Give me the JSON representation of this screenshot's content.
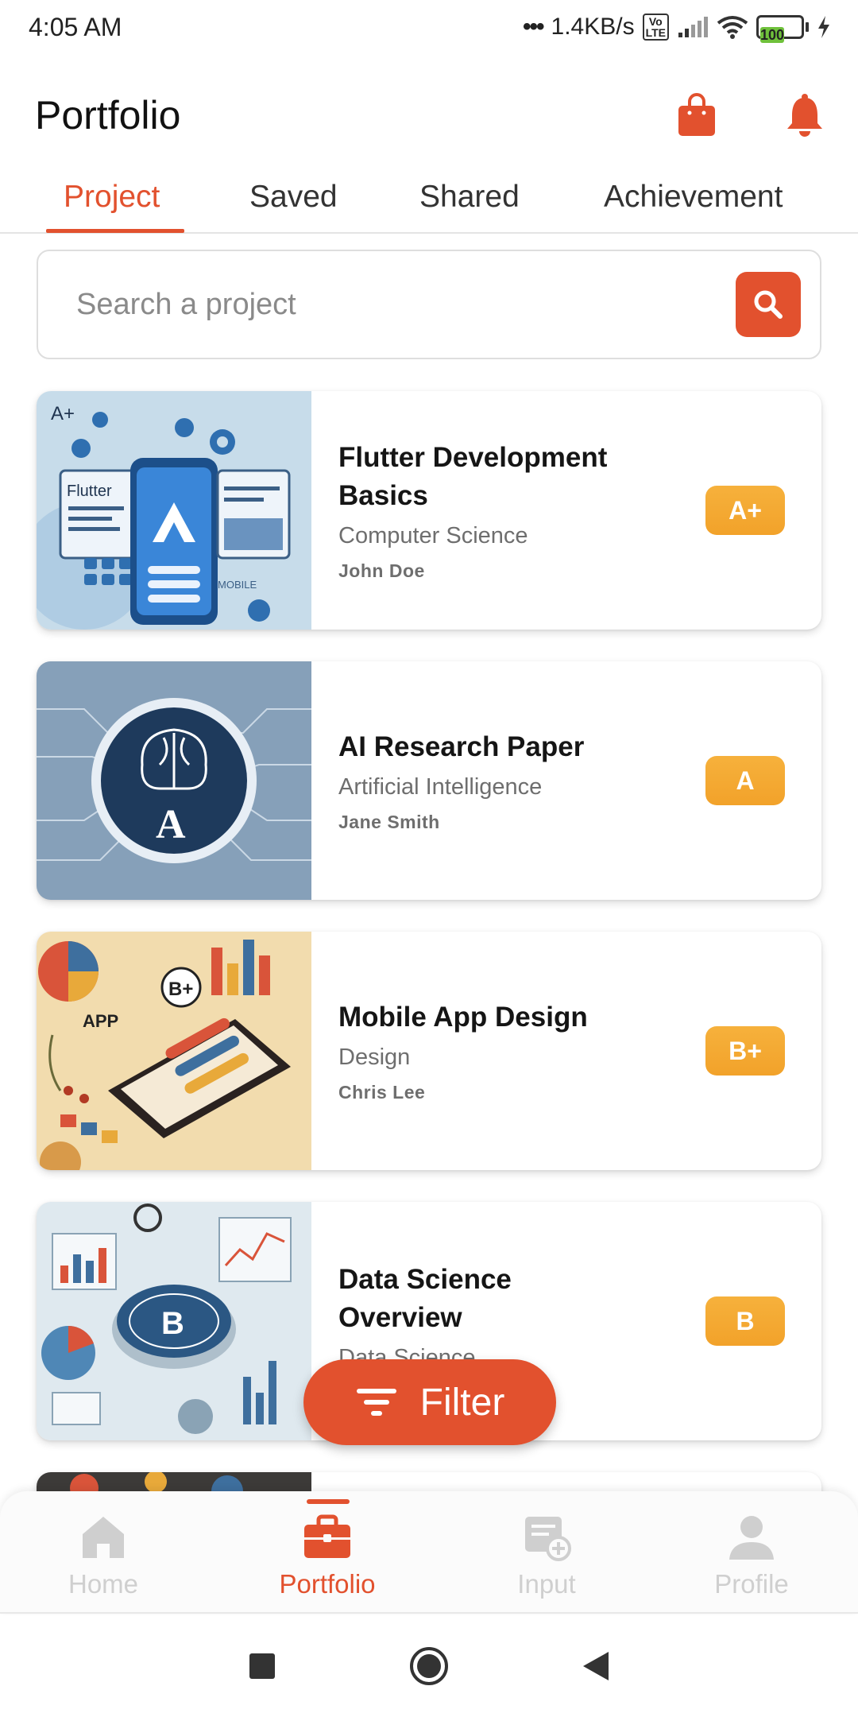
{
  "status_bar": {
    "time": "4:05 AM",
    "network_speed": "1.4KB/s",
    "volte": "Vo LTE",
    "battery": "100"
  },
  "header": {
    "title": "Portfolio",
    "icons": [
      "shopping-bag-icon",
      "bell-icon"
    ]
  },
  "tabs": [
    {
      "label": "Project",
      "active": true
    },
    {
      "label": "Saved",
      "active": false
    },
    {
      "label": "Shared",
      "active": false
    },
    {
      "label": "Achievement",
      "active": false
    }
  ],
  "search": {
    "placeholder": "Search a project",
    "icon": "search-icon"
  },
  "projects": [
    {
      "title": "Flutter Development Basics",
      "subject": "Computer Science",
      "author": "John Doe",
      "grade": "A+"
    },
    {
      "title": "AI Research Paper",
      "subject": "Artificial Intelligence",
      "author": "Jane Smith",
      "grade": "A"
    },
    {
      "title": "Mobile App Design",
      "subject": "Design",
      "author": "Chris Lee",
      "grade": "B+"
    },
    {
      "title": "Data Science Overview",
      "subject": "Data Science",
      "author": "",
      "grade": "B"
    }
  ],
  "filter_button": {
    "label": "Filter",
    "icon": "filter-icon"
  },
  "bottom_nav": [
    {
      "label": "Home",
      "icon": "home-icon",
      "active": false
    },
    {
      "label": "Portfolio",
      "icon": "briefcase-icon",
      "active": true
    },
    {
      "label": "Input",
      "icon": "add-document-icon",
      "active": false
    },
    {
      "label": "Profile",
      "icon": "person-icon",
      "active": false
    }
  ],
  "colors": {
    "accent": "#e2512e",
    "grade": "#f2a22a",
    "inactive": "#cfcfcf"
  }
}
